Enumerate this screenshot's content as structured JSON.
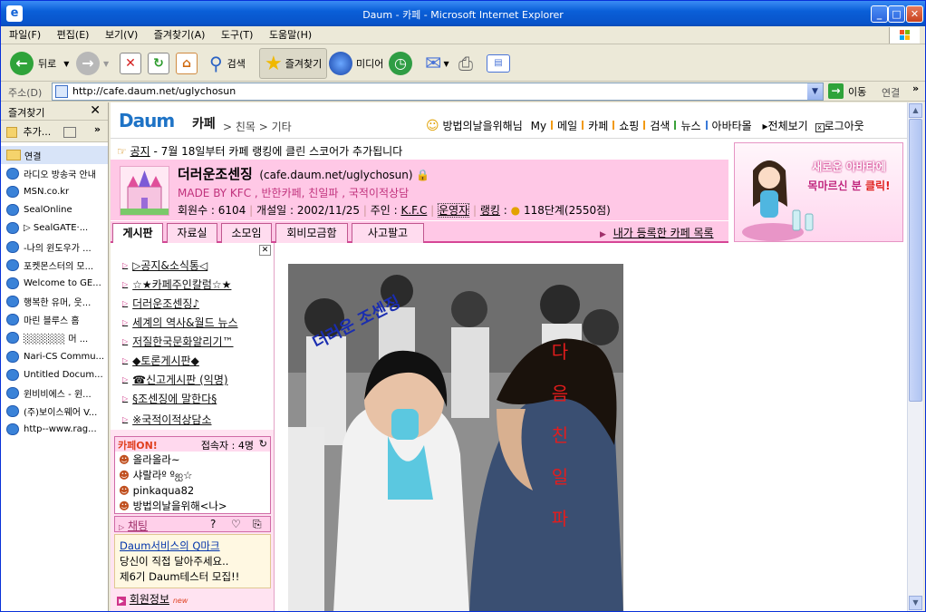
{
  "window": {
    "title": "Daum - 카페 - Microsoft Internet Explorer"
  },
  "menu": [
    "파일(F)",
    "편집(E)",
    "보기(V)",
    "즐겨찾기(A)",
    "도구(T)",
    "도움말(H)"
  ],
  "toolbar": {
    "back": "뒤로",
    "search": "검색",
    "favorites": "즐겨찾기",
    "media": "미디어"
  },
  "address": {
    "label": "주소(D)",
    "url": "http://cafe.daum.net/uglychosun",
    "go": "이동",
    "links": "연결"
  },
  "favorites": {
    "title": "즐겨찾기",
    "add": "추가...",
    "items": [
      "연결",
      "라디오 방송국 안내",
      "MSN.co.kr",
      "SealOnline",
      "▷ SealGATE·...",
      "-나의 윈도우가 ...",
      "포켓몬스터의 모...",
      "Welcome to GE...",
      "행복한 유머, 웃...",
      "마린 블루스 홈",
      "░░░░░░ 머 ...",
      "Nari-CS Commu...",
      "Untitled Docum...",
      "윈비비에스 - 윈...",
      "(주)보이스웨어  V...",
      "http--www.rag..."
    ]
  },
  "topnav": {
    "logo": "Daum",
    "cafe": "카페",
    "breadcrumb": "> 친목 > 기타",
    "user": "방법의날을위해님",
    "links": [
      "My",
      "메일",
      "카페",
      "쇼핑",
      "검색",
      "뉴스",
      "아바타몰"
    ],
    "viewall": "▸전체보기",
    "logout": "로그아웃"
  },
  "notice": {
    "label": "공지",
    "text": "- 7월 18일부터 카페 랭킹에 클린 스코어가 추가됩니다"
  },
  "cafe": {
    "name": "더러운조센징",
    "url": "(cafe.daum.net/uglychosun)",
    "desc": "MADE BY KFC , 반한카페, 친일파 , 국적이적상담",
    "members": "회원수 : 6104",
    "founded": "개설일 : 2002/11/25",
    "owner_label": "주인 :",
    "owner": "K.F.C",
    "operators": "운영자",
    "rank_label": "랭킹",
    "rank": ":",
    "level": "118단계(2550점)"
  },
  "tabs": [
    "게시판",
    "자료실",
    "소모임",
    "회비모금함",
    "사고팔고"
  ],
  "mycafes": "내가 등록한 카페 목록",
  "boards": [
    "▷공지&소식통◁",
    "☆★카페주인칼럼☆★",
    "더러운조센징♪",
    "세계의 역사&월드 뉴스",
    "저질한국문화알리기™",
    "◆토론게시판◆",
    "☎신고게시판 (익명)",
    "§조센징에 말한다§",
    "※국적이적상담소"
  ],
  "cafeon": {
    "label": "카페ON!",
    "count": "접속자 : 4명",
    "users": [
      "올라올라~",
      "샤랄라º ºஐ☆",
      "pinkaqua82",
      "방법의날을위해<나>"
    ]
  },
  "chat": {
    "label": "채팅",
    "q": "?"
  },
  "ads": {
    "qmark": "Daum서비스의 Q마크",
    "line1": "당신이 직접 달아주세요..",
    "line2": "제6기 Daum테스터 모집!!"
  },
  "member": {
    "label": "회원정보",
    "new": "new"
  },
  "banner": {
    "line1": "새로운 아바타에",
    "line2": "목마르신 분",
    "click": "클릭!"
  },
  "photo": {
    "caption1": "더러운 조센징",
    "caption2": "다음친일파"
  }
}
